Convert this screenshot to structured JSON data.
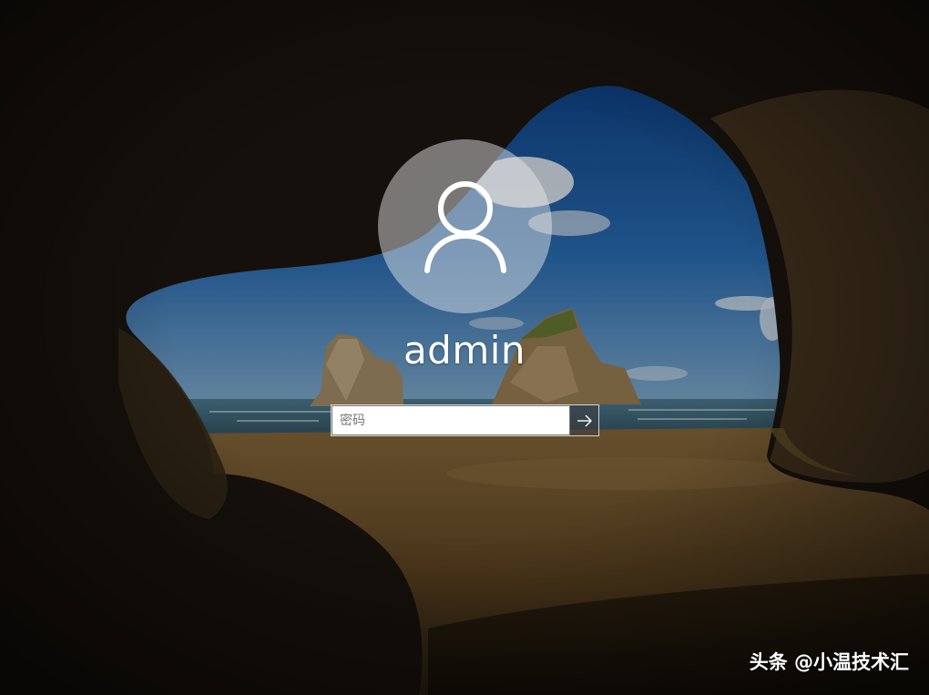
{
  "login": {
    "username": "admin",
    "password_placeholder": "密码"
  },
  "icons": {
    "avatar": "user-silhouette-icon",
    "submit": "arrow-right-icon"
  },
  "watermark": {
    "text": "头条 @小温技术汇"
  },
  "colors": {
    "sky": "#1a5ea8",
    "sand": "#7a5a2c",
    "cave": "#2a2118",
    "avatar_circle": "#c9ccd0",
    "text": "#ffffff"
  }
}
